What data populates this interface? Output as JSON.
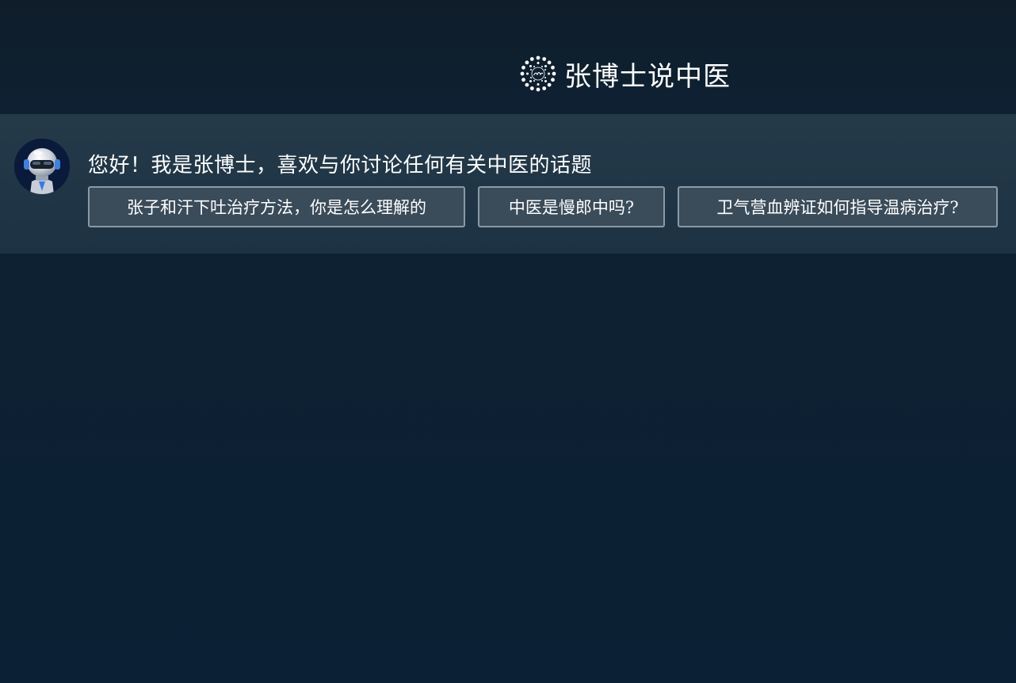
{
  "header": {
    "title": "张博士说中医",
    "logo_icon": "dotted-circle-logo-icon"
  },
  "chat": {
    "avatar_icon": "robot-avatar-icon",
    "greeting": "您好！我是张博士，喜欢与你讨论任何有关中医的话题",
    "suggestions": [
      {
        "label": "张子和汗下吐治疗方法，你是怎么理解的"
      },
      {
        "label": "中医是慢郎中吗?"
      },
      {
        "label": "卫气营血辨证如何指导温病治疗?"
      }
    ]
  },
  "colors": {
    "background": "#0e2133",
    "panel": "#243a49",
    "chip_background": "#3a4b59",
    "chip_border": "#8a9aa7",
    "text": "#ffffff"
  }
}
